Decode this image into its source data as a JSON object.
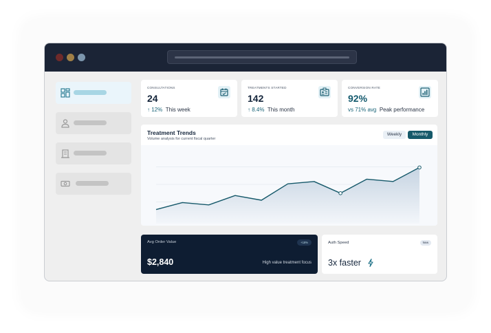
{
  "colors": {
    "titlebar": "#1b2436",
    "accent_teal": "#16596a",
    "navy_card": "#0e1d32",
    "chart_line": "#16596a"
  },
  "sidebar": {
    "items": [
      {
        "icon": "dashboard-grid-icon",
        "active": true
      },
      {
        "icon": "user-icon",
        "active": false
      },
      {
        "icon": "building-icon",
        "active": false
      },
      {
        "icon": "cash-icon",
        "active": false
      }
    ]
  },
  "stats": [
    {
      "label": "CONSULTATIONS",
      "value": "24",
      "change": "↑ 12%",
      "note": "This week",
      "icon": "calendar-check-icon"
    },
    {
      "label": "TREATMENTS STARTED",
      "value": "142",
      "change": "↑ 8.4%",
      "note": "This month",
      "icon": "id-card-icon"
    },
    {
      "label": "CONVERSION RATE",
      "value": "92%",
      "change": "vs 71% avg",
      "note": "Peak performance",
      "icon": "bar-chart-icon"
    }
  ],
  "trend": {
    "title": "Treatment Trends",
    "subtitle": "Volume analysis for current fiscal quarter",
    "toggle": {
      "weekly": "Weekly",
      "monthly": "Monthly",
      "selected": "monthly"
    }
  },
  "chart_data": {
    "type": "area",
    "title": "Treatment Trends",
    "subtitle": "Volume analysis for current fiscal quarter",
    "x": [
      0,
      1,
      2,
      3,
      4,
      5,
      6,
      7,
      8,
      9,
      10,
      11
    ],
    "values": [
      6,
      9,
      8,
      12,
      10,
      17,
      18,
      13,
      19,
      18,
      24,
      null
    ],
    "ylim": [
      0,
      30
    ],
    "grid": true,
    "highlighted_points": [
      7,
      10
    ]
  },
  "aov": {
    "label": "Avg Order Value",
    "badge": "+18%",
    "value": "$2,840",
    "note": "High value treatment focus"
  },
  "auth": {
    "label": "Auth Speed",
    "badge": "New",
    "value": "3x faster",
    "icon": "lightning-bolt-icon"
  }
}
